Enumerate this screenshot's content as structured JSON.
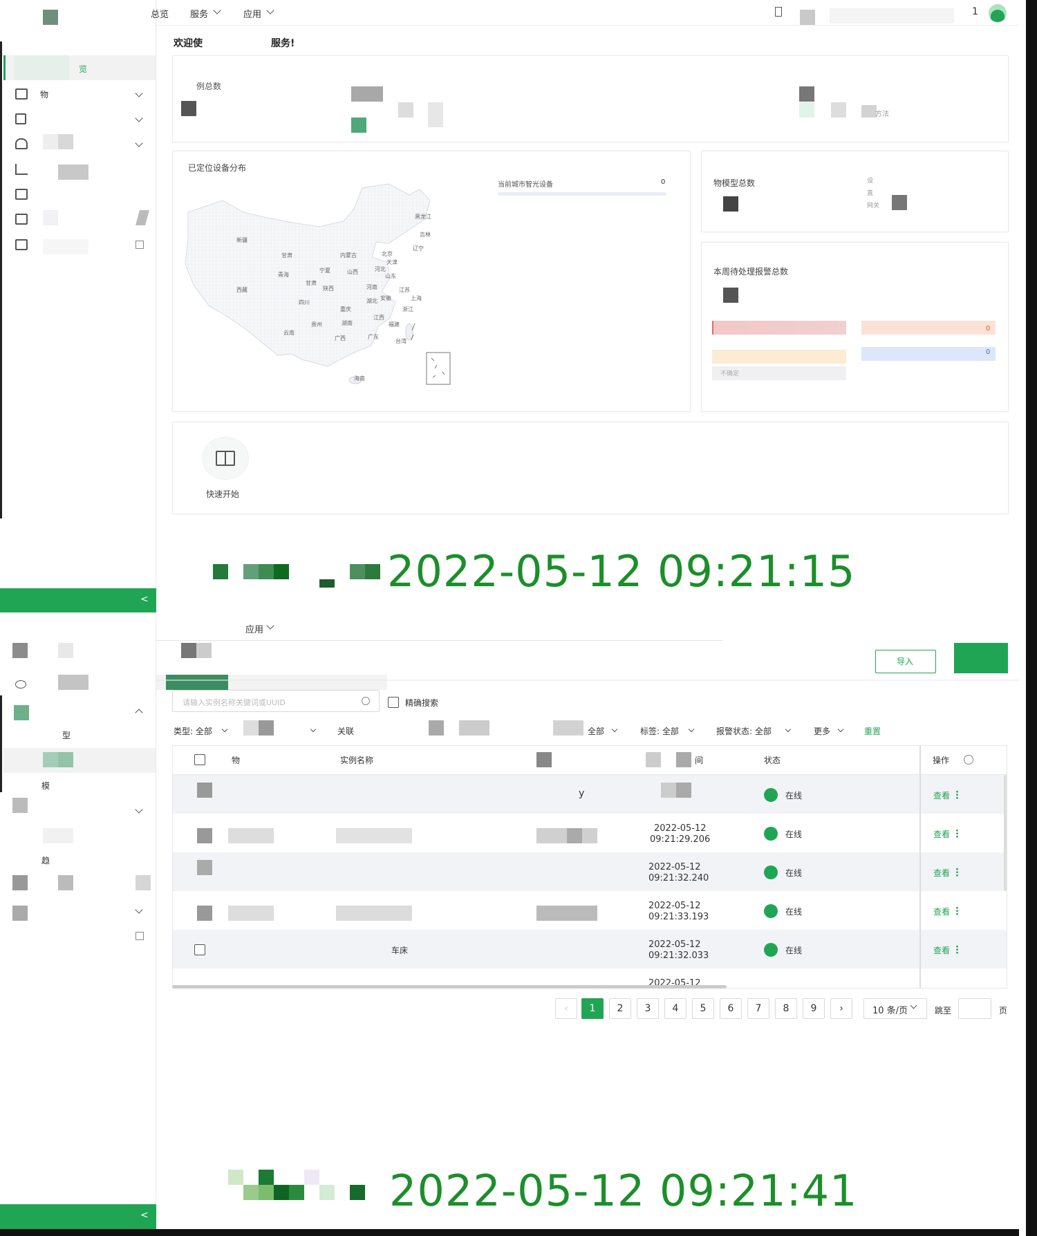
{
  "top": {
    "nav": [
      "总览",
      "服务",
      "应用"
    ],
    "user_digit": "1",
    "welcome": "欢迎使",
    "welcome_tail": "服务!"
  },
  "sidebar1": {
    "active": "览",
    "item1": "物",
    "collapse": "<"
  },
  "stats": {
    "instances_label": "例总数",
    "method_hint": "方法"
  },
  "map": {
    "title": "已定位设备分布",
    "current_city_label": "当前城市智光设备",
    "current_city_value": "0",
    "provinces": [
      "黑龙江",
      "吉林",
      "辽宁",
      "新疆",
      "甘肃",
      "内蒙古",
      "北京",
      "天津",
      "河北",
      "青海",
      "宁夏",
      "山西",
      "山东",
      "西藏",
      "甘肃",
      "陕西",
      "河南",
      "江苏",
      "安徽",
      "上海",
      "四川",
      "湖北",
      "重庆",
      "浙江",
      "江西",
      "湖南",
      "贵州",
      "福建",
      "云南",
      "广西",
      "广东",
      "台湾",
      "海南"
    ]
  },
  "model": {
    "title": "物模型总数",
    "legend": [
      "设",
      "直",
      "网关"
    ]
  },
  "alarm": {
    "title": "本周待处理报警总数",
    "values": [
      "0",
      "0"
    ],
    "undetermined": "不确定"
  },
  "quick": {
    "label": "快速开始"
  },
  "stamps": [
    "2022-05-12 09:21:15",
    "2022-05-12 09:21:41"
  ],
  "screen2": {
    "nav_tail": "应用",
    "import_btn": "导入",
    "search_placeholder": "请输入实例名称关键词或UUID",
    "exact_search": "精确搜索",
    "filters": [
      "类型: 全部",
      "关联",
      "全部",
      "标签: 全部",
      "报警状态: 全部",
      "更多",
      "重置"
    ],
    "columns": [
      "物",
      "实例名称",
      "间",
      "状态",
      "操作"
    ],
    "rows": [
      {
        "mid": "y",
        "time1": "",
        "time2": "",
        "status": "在线",
        "action": "查看"
      },
      {
        "mid": "",
        "time1": "2022-05-12",
        "time2": "09:21:29.206",
        "status": "在线",
        "action": "查看"
      },
      {
        "mid": "",
        "time1": "2022-05-12",
        "time2": "09:21:32.240",
        "status": "在线",
        "action": "查看"
      },
      {
        "mid": "",
        "time1": "2022-05-12",
        "time2": "09:21:33.193",
        "status": "在线",
        "action": "查看"
      },
      {
        "mid": "车床",
        "time1": "2022-05-12",
        "time2": "09:21:32.033",
        "status": "在线",
        "action": "查看"
      },
      {
        "mid": "",
        "time1": "2022-05-12",
        "time2": "",
        "status": "",
        "action": ""
      }
    ],
    "pages": [
      "1",
      "2",
      "3",
      "4",
      "5",
      "6",
      "7",
      "8",
      "9"
    ],
    "page_size": "10 条/页",
    "jump": "跳至",
    "page_unit": "页",
    "side": {
      "a": "型",
      "b": "模",
      "c": "趋"
    }
  }
}
